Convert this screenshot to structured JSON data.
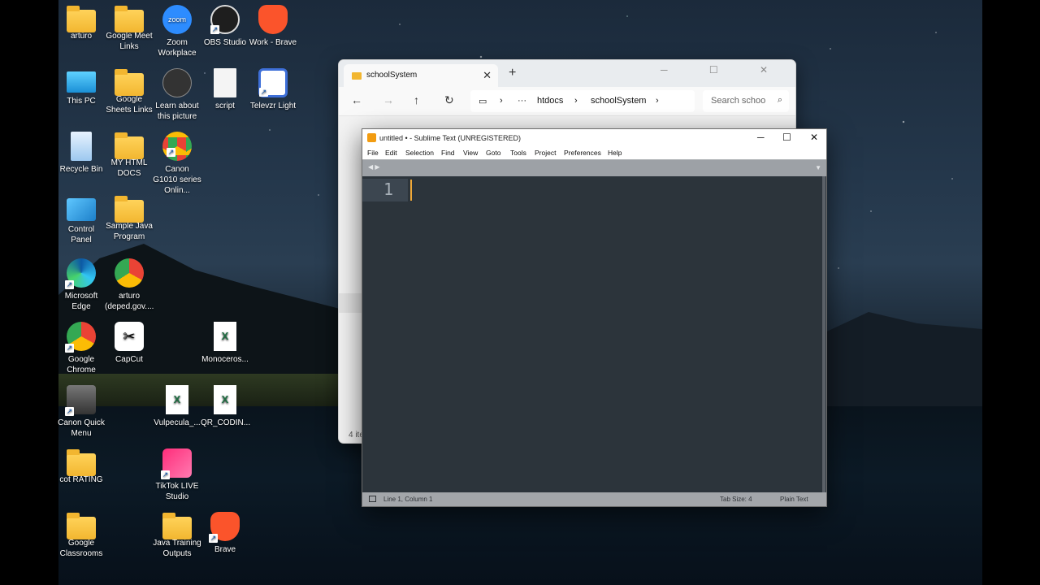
{
  "desktop": {
    "icons": [
      {
        "label": "arturo",
        "icon": "user-folder-icon"
      },
      {
        "label": "Google Meet Links",
        "icon": "folder-icon"
      },
      {
        "label": "Zoom Workplace",
        "icon": "zoom-icon"
      },
      {
        "label": "OBS Studio",
        "icon": "obs-icon"
      },
      {
        "label": "Work - Brave",
        "icon": "brave-icon"
      },
      {
        "label": "This PC",
        "icon": "monitor-icon"
      },
      {
        "label": "Google Sheets Links",
        "icon": "folder-icon"
      },
      {
        "label": "Learn about this picture",
        "icon": "camera-icon"
      },
      {
        "label": "script",
        "icon": "document-icon"
      },
      {
        "label": "Televzr Light",
        "icon": "televzr-icon"
      },
      {
        "label": "Recycle Bin",
        "icon": "recycle-bin-icon"
      },
      {
        "label": "MY HTML DOCS",
        "icon": "folder-icon"
      },
      {
        "label": "Canon G1010 series Onlin...",
        "icon": "chrome-icon"
      },
      {
        "label": "Control Panel",
        "icon": "control-panel-icon"
      },
      {
        "label": "Sample Java Program",
        "icon": "folder-icon"
      },
      {
        "label": "Microsoft Edge",
        "icon": "edge-icon"
      },
      {
        "label": "arturo (deped.gov....",
        "icon": "chrome-profile-icon"
      },
      {
        "label": "Google Chrome",
        "icon": "chrome-icon"
      },
      {
        "label": "CapCut",
        "icon": "capcut-icon"
      },
      {
        "label": "Monoceros...",
        "icon": "excel-icon"
      },
      {
        "label": "Canon Quick Menu",
        "icon": "canon-icon"
      },
      {
        "label": "Vulpecula_...",
        "icon": "excel-icon"
      },
      {
        "label": "QR_CODIN...",
        "icon": "excel-icon"
      },
      {
        "label": "cot RATING",
        "icon": "folder-icon"
      },
      {
        "label": "TikTok LIVE Studio",
        "icon": "tiktok-icon"
      },
      {
        "label": "Google Classrooms",
        "icon": "folder-icon"
      },
      {
        "label": "Java Training Outputs",
        "icon": "folder-icon"
      },
      {
        "label": "Brave",
        "icon": "brave-icon"
      }
    ]
  },
  "explorer": {
    "tab_title": "schoolSystem",
    "tab_close": "✕",
    "new_tab": "+",
    "window_buttons": "─ ☐ ✕",
    "nav": {
      "back": "←",
      "forward": "→",
      "up": "↑",
      "refresh": "↻"
    },
    "address": {
      "pc_icon": "▭",
      "sep": "›",
      "more": "···",
      "crumb1": "htdocs",
      "crumb2": "schoolSystem"
    },
    "search_placeholder": "Search schoo",
    "status": "4 ite"
  },
  "sublime": {
    "title": "untitled • - Sublime Text (UNREGISTERED)",
    "window_buttons": {
      "min": "─",
      "max": "☐",
      "close": "✕"
    },
    "menu": [
      "File",
      "Edit",
      "Selection",
      "Find",
      "View",
      "Goto",
      "Tools",
      "Project",
      "Preferences",
      "Help"
    ],
    "tab_arrows": "◀ ▶",
    "tab_dropdown": "▼",
    "line_number": "1",
    "status": {
      "position": "Line 1, Column 1",
      "tab_size": "Tab Size: 4",
      "syntax": "Plain Text"
    }
  },
  "colors": {
    "sublime_bg": "#2c343b",
    "caret": "#f0a838",
    "folder": "#f2b630"
  }
}
